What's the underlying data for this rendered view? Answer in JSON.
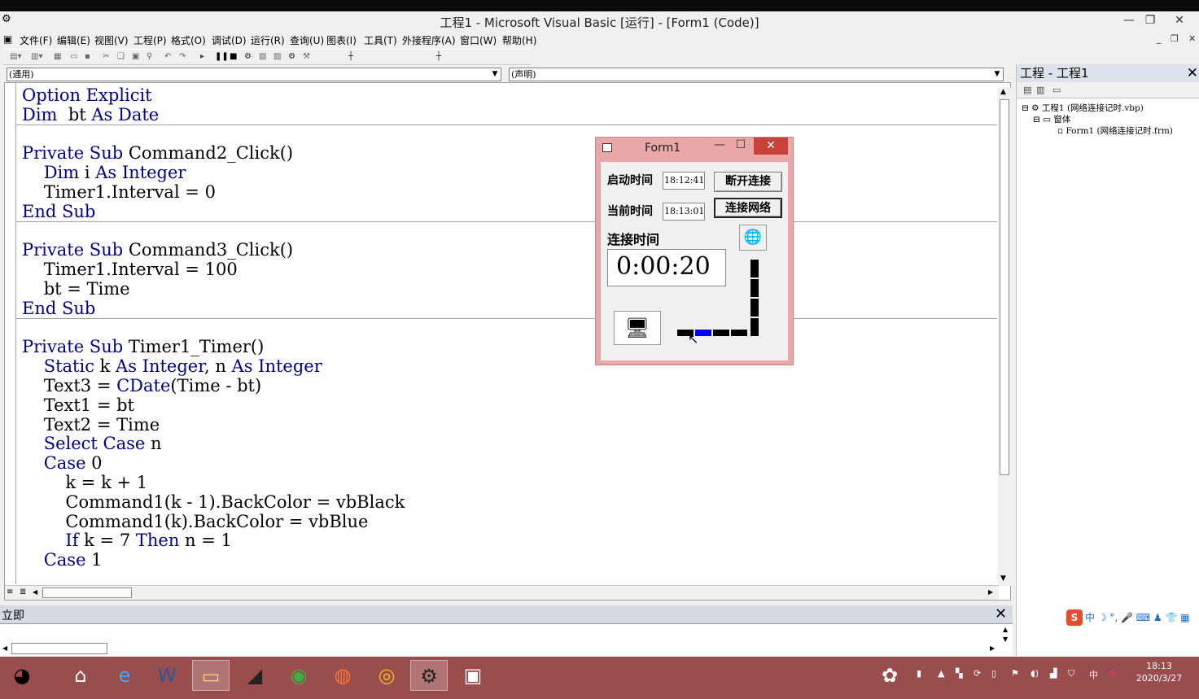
{
  "window": {
    "title": "工程1 - Microsoft Visual Basic [运行] - [Form1 (Code)]",
    "minimize": "—",
    "restore": "❐",
    "close": "✕"
  },
  "menu": [
    "文件(F)",
    "编辑(E)",
    "视图(V)",
    "工程(P)",
    "格式(O)",
    "调试(D)",
    "运行(R)",
    "查询(U)",
    "图表(I)",
    "工具(T)",
    "外接程序(A)",
    "窗口(W)",
    "帮助(H)"
  ],
  "combos": {
    "object": "(通用)",
    "procedure": "(声明)"
  },
  "code": {
    "lines": [
      [
        [
          "kw",
          "Option Explicit"
        ]
      ],
      [
        [
          "kw",
          "Dim"
        ],
        [
          "",
          "  bt "
        ],
        [
          "kw",
          "As Date"
        ]
      ],
      [],
      [
        [
          "kw",
          "Private Sub"
        ],
        [
          "",
          " Command2_Click()"
        ]
      ],
      [
        [
          "",
          "    "
        ],
        [
          "kw",
          "Dim"
        ],
        [
          "",
          " i "
        ],
        [
          "kw",
          "As Integer"
        ]
      ],
      [
        [
          "",
          "    Timer1.Interval = 0"
        ]
      ],
      [
        [
          "kw",
          "End Sub"
        ]
      ],
      [],
      [
        [
          "kw",
          "Private Sub"
        ],
        [
          "",
          " Command3_Click()"
        ]
      ],
      [
        [
          "",
          "    Timer1.Interval = 100"
        ]
      ],
      [
        [
          "",
          "    bt = Time"
        ]
      ],
      [
        [
          "kw",
          "End Sub"
        ]
      ],
      [],
      [
        [
          "kw",
          "Private Sub"
        ],
        [
          "",
          " Timer1_Timer()"
        ]
      ],
      [
        [
          "",
          "    "
        ],
        [
          "kw",
          "Static"
        ],
        [
          "",
          " k "
        ],
        [
          "kw",
          "As Integer"
        ],
        [
          "",
          ", n "
        ],
        [
          "kw",
          "As Integer"
        ]
      ],
      [
        [
          "",
          "    Text3 = "
        ],
        [
          "kw",
          "CDate"
        ],
        [
          "",
          "(Time - bt)"
        ]
      ],
      [
        [
          "",
          "    Text1 = bt"
        ]
      ],
      [
        [
          "",
          "    Text2 = Time"
        ]
      ],
      [
        [
          "",
          "    "
        ],
        [
          "kw",
          "Select Case"
        ],
        [
          "",
          " n"
        ]
      ],
      [
        [
          "",
          "    "
        ],
        [
          "kw",
          "Case"
        ],
        [
          "",
          " 0"
        ]
      ],
      [
        [
          "",
          "        k = k + 1"
        ]
      ],
      [
        [
          "",
          "        Command1(k - 1).BackColor = vbBlack"
        ]
      ],
      [
        [
          "",
          "        Command1(k).BackColor = vbBlue"
        ]
      ],
      [
        [
          "",
          "        "
        ],
        [
          "kw",
          "If"
        ],
        [
          "",
          " k = 7 "
        ],
        [
          "kw",
          "Then"
        ],
        [
          "",
          " n = 1"
        ]
      ],
      [
        [
          "",
          "    "
        ],
        [
          "kw",
          "Case"
        ],
        [
          "",
          " 1"
        ]
      ]
    ]
  },
  "immediate": {
    "title": "立即",
    "close": "✕"
  },
  "project": {
    "title": "工程 - 工程1",
    "close": "✕",
    "tree": {
      "project": "工程1 (网络连接记时.vbp)",
      "folder": "窗体",
      "form": "Form1 (网络连接记时.frm)"
    }
  },
  "form1": {
    "title": "Form1",
    "minimize": "—",
    "maximize": "☐",
    "close": "✕",
    "start_label": "启动时间",
    "start_value": "18:12:41",
    "current_label": "当前时间",
    "current_value": "18:13:01",
    "elapsed_label": "连接时间",
    "elapsed_value": "0:00:20",
    "disconnect_button": "断开连接",
    "connect_button": "连接网络",
    "progress_active_index": 1
  },
  "taskbar": {
    "clock_time": "18:13",
    "clock_date": "2020/3/27"
  },
  "colors": {
    "form_border": "#e9a7a7",
    "code_keyword": "#00008b",
    "taskbar": "#9a4d4d",
    "progress_active": "#0000ff",
    "progress_inactive": "#000000"
  }
}
